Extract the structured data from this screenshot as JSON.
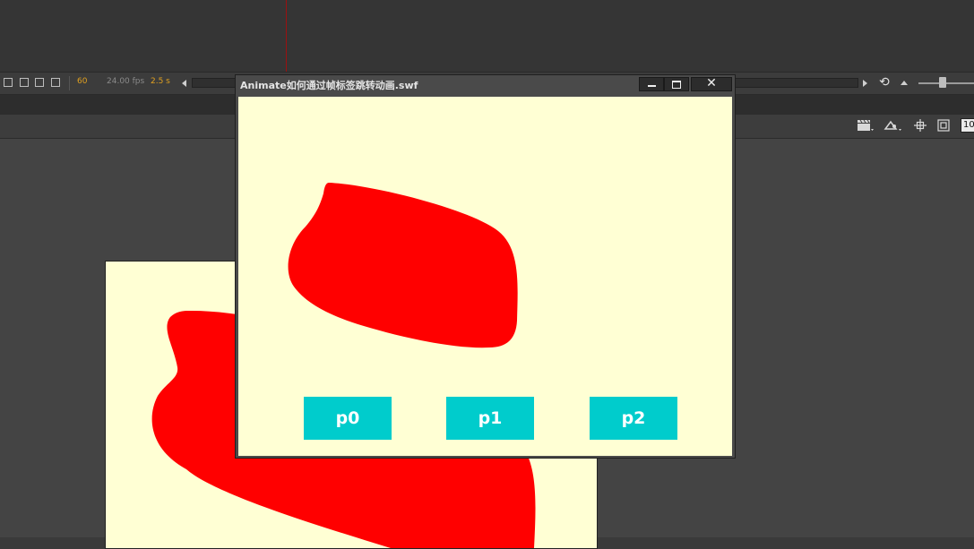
{
  "timeline": {
    "frame": "60",
    "fps": "24.00 fps",
    "time": "2.5 s"
  },
  "edit_bar": {
    "zoom_value": "10"
  },
  "swf_window": {
    "title": "Animate如何通过帧标签跳转动画.swf",
    "buttons": [
      {
        "label": "p0"
      },
      {
        "label": "p1"
      },
      {
        "label": "p2"
      }
    ]
  },
  "colors": {
    "shape_fill": "#ff0000",
    "stage_bg": "#ffffd4",
    "button_bg": "#00cccc",
    "playhead": "#9b1111"
  },
  "icons": {
    "loop": "loop-icon",
    "close": "close-icon",
    "minimize": "minimize-icon",
    "maximize": "maximize-icon"
  }
}
